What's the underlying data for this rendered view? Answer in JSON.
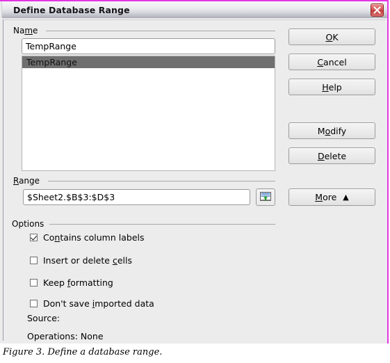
{
  "window": {
    "title": "Define Database Range",
    "close_icon": "close-icon",
    "accent_color": "#e535e5",
    "titlebar_text_color": "#16161a"
  },
  "name_group": {
    "label": "Name",
    "label_before": "Na",
    "label_accel": "m",
    "label_after": "e",
    "input_value": "TempRange",
    "input_placeholder": "",
    "list_items": [
      {
        "label": "TempRange",
        "selected": true
      }
    ],
    "selection_color": "#6f6f6f"
  },
  "range_group": {
    "label": "Range",
    "label_accel": "R",
    "label_after": "ange",
    "input_value": "$Sheet2.$B$3:$D$3",
    "input_placeholder": "",
    "picker_icon": "shrink-range-icon"
  },
  "options_group": {
    "label": "Options",
    "checkboxes": [
      {
        "before": "Co",
        "accel": "n",
        "after": "tains column labels",
        "full": "Contains column labels",
        "checked": true
      },
      {
        "before": "Insert or delete ",
        "accel": "c",
        "after": "ells",
        "full": "Insert or delete cells",
        "checked": false
      },
      {
        "before": "Keep ",
        "accel": "f",
        "after": "ormatting",
        "full": "Keep formatting",
        "checked": false
      },
      {
        "before": "Don't save ",
        "accel": "i",
        "after": "mported data",
        "full": "Don't save imported data",
        "checked": false
      }
    ],
    "source_text": "Source:",
    "operations_text": "Operations: None"
  },
  "buttons": {
    "ok": {
      "before": "",
      "accel": "O",
      "after": "K",
      "full": "OK"
    },
    "cancel": {
      "before": "",
      "accel": "C",
      "after": "ancel",
      "full": "Cancel"
    },
    "help": {
      "before": "",
      "accel": "H",
      "after": "elp",
      "full": "Help"
    },
    "modify": {
      "before": "M",
      "accel": "o",
      "after": "dify",
      "full": "Modify"
    },
    "delete": {
      "before": "",
      "accel": "D",
      "after": "elete",
      "full": "Delete"
    },
    "more": {
      "before": "",
      "accel": "M",
      "after": "ore",
      "full": "More",
      "arrow": "▲"
    }
  },
  "caption": {
    "text": "Figure 3. Define a database range."
  }
}
